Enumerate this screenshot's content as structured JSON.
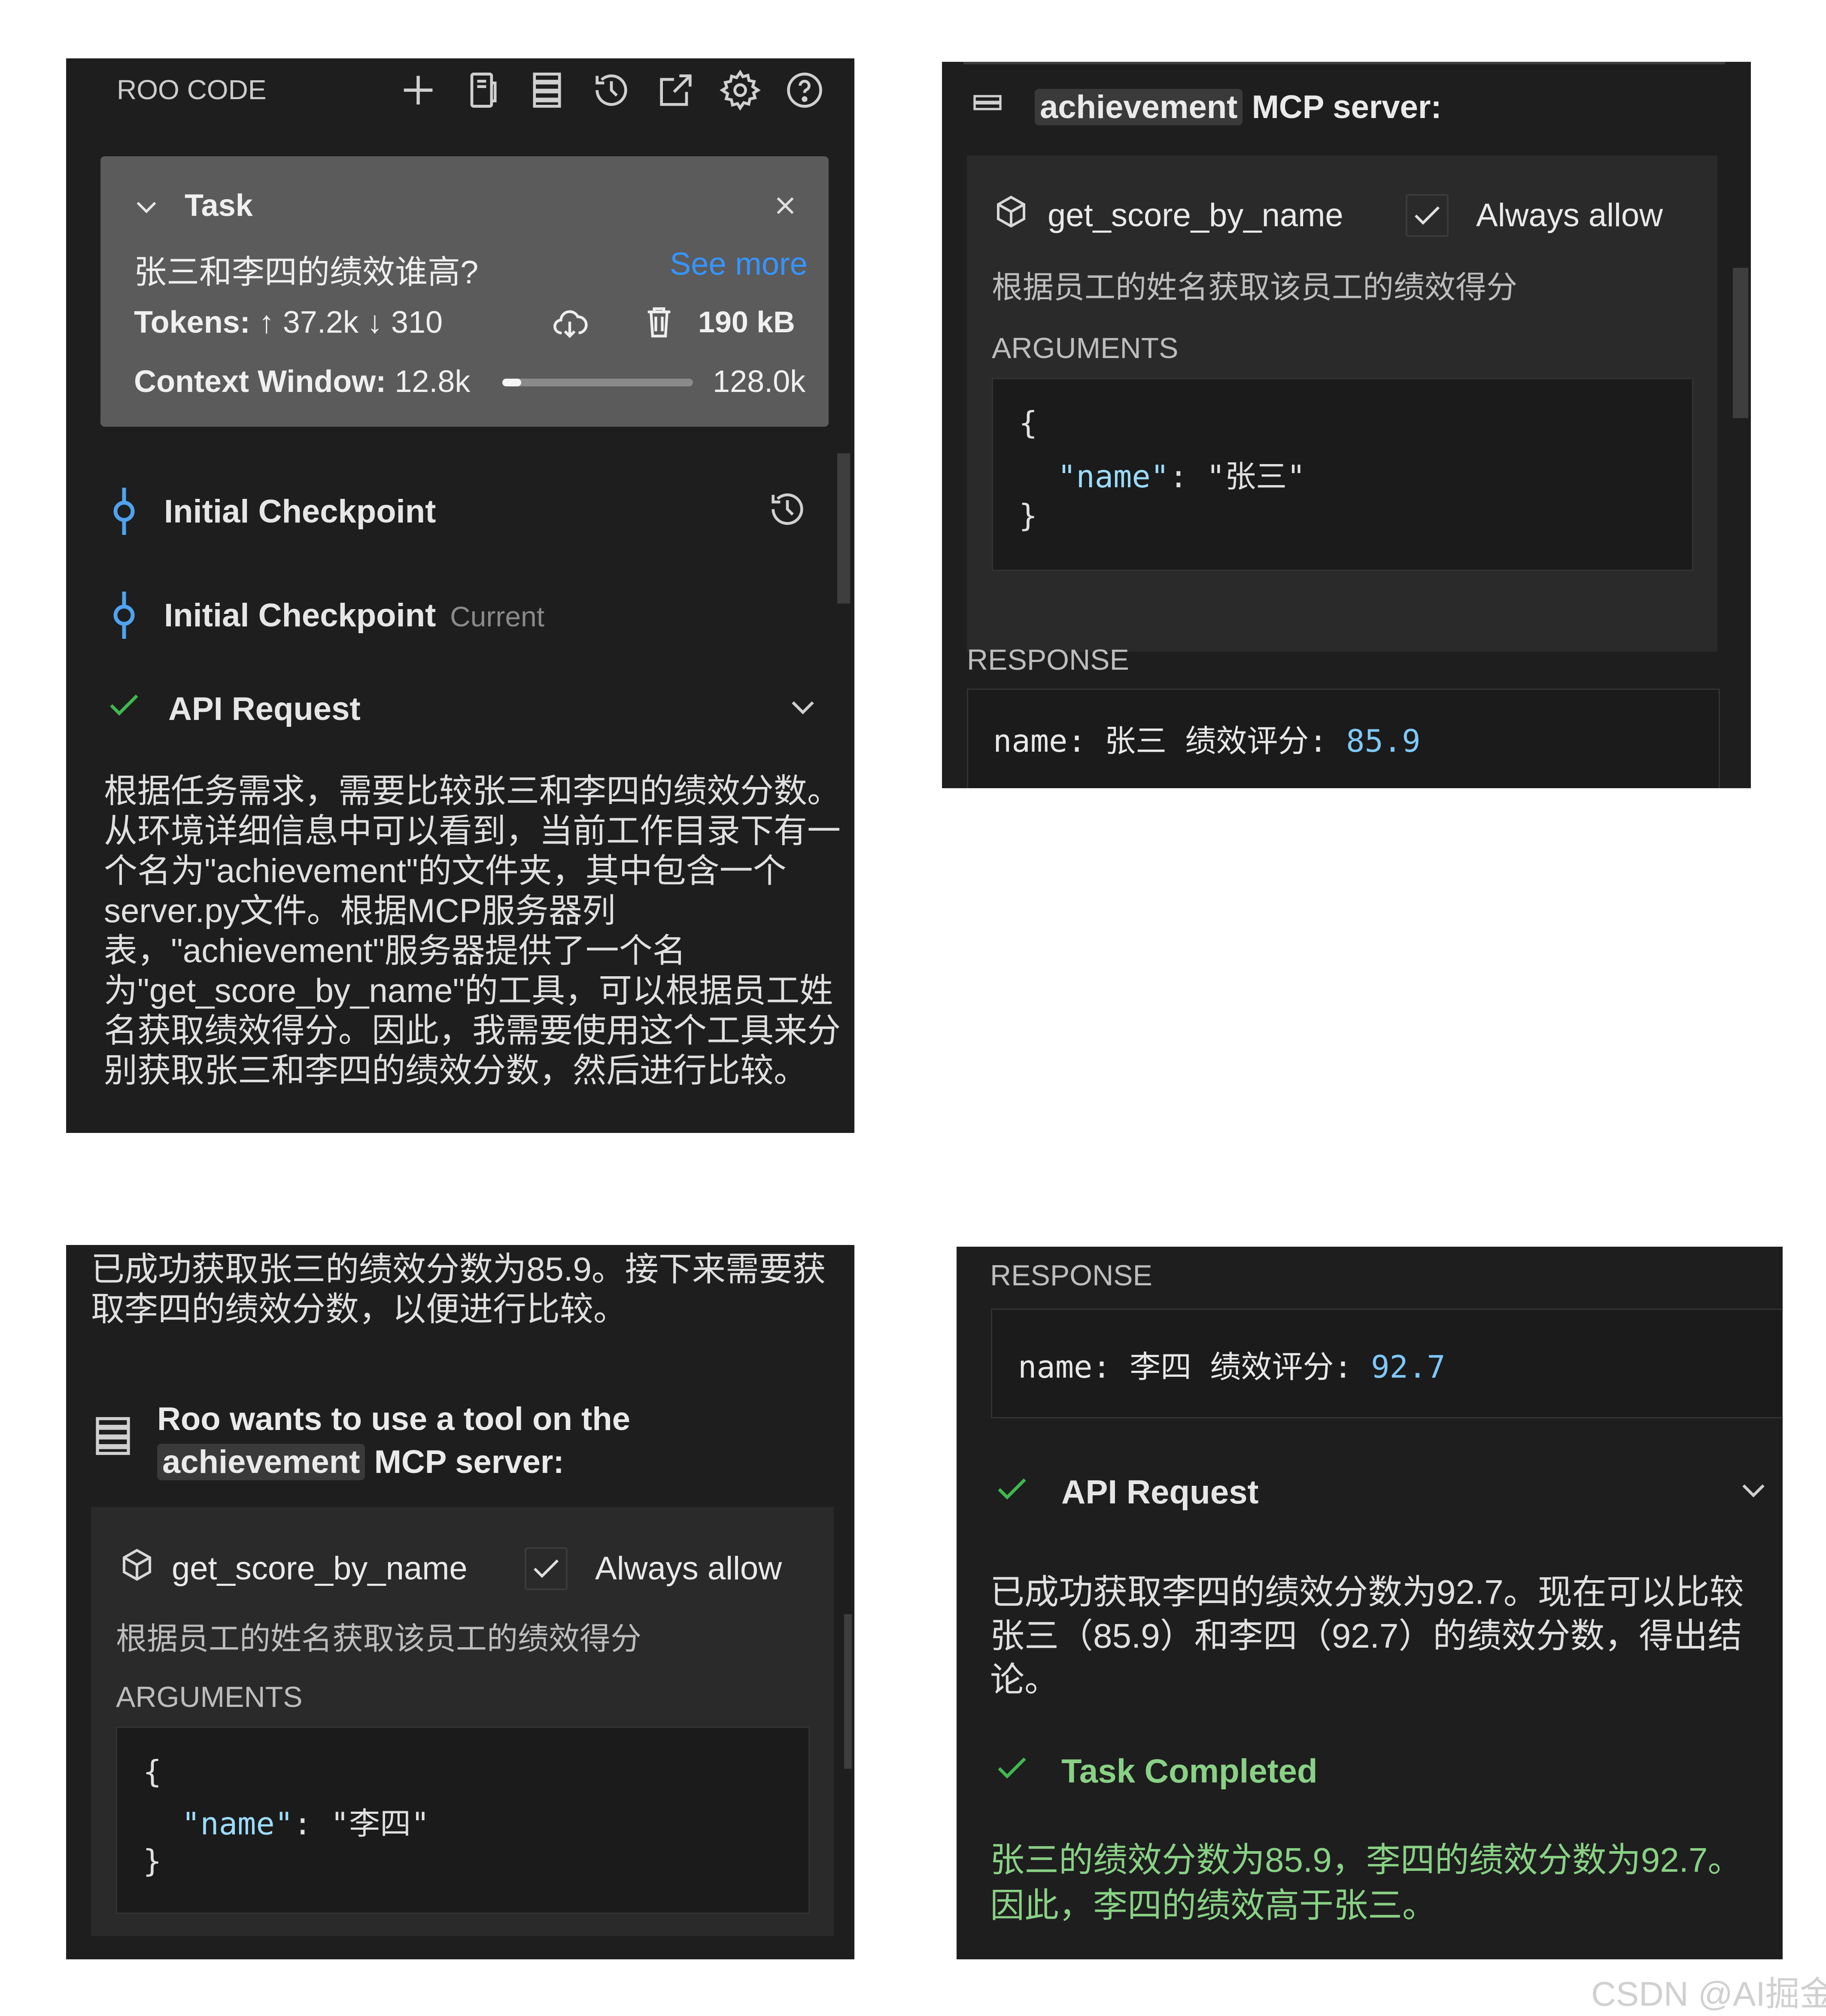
{
  "panel1": {
    "title": "ROO CODE",
    "toolbar_icons": [
      "plus-icon",
      "document-icon",
      "server-list-icon",
      "history-icon",
      "popout-icon",
      "gear-icon",
      "help-icon"
    ],
    "task": {
      "label": "Task",
      "question": "张三和李四的绩效谁高?",
      "see_more": "See more",
      "tokens_label": "Tokens:",
      "tokens_up": "37.2k",
      "tokens_down": "310",
      "size": "190 kB",
      "context_label": "Context Window:",
      "context_used": "12.8k",
      "context_max": "128.0k",
      "context_fraction": 0.1
    },
    "checkpoint1": "Initial Checkpoint",
    "checkpoint2": "Initial Checkpoint",
    "checkpoint2_badge": "Current",
    "api_request": "API Request",
    "reasoning_lines": [
      "根据任务需求，需要比较张三和李四的绩效分数。",
      "从环境详细信息中可以看到，当前工作目录下有一",
      "个名为\"achievement\"的文件夹，其中包含一个",
      "server.py文件。根据MCP服务器列",
      "表，\"achievement\"服务器提供了一个名",
      "为\"get_score_by_name\"的工具，可以根据员工姓",
      "名获取绩效得分。因此，我需要使用这个工具来分",
      "别获取张三和李四的绩效分数，然后进行比较。"
    ]
  },
  "panel2": {
    "server_name": "achievement",
    "server_suffix": "MCP server:",
    "tool_name": "get_score_by_name",
    "always_allow": "Always allow",
    "tool_desc": "根据员工的姓名获取该员工的绩效得分",
    "arguments_label": "ARGUMENTS",
    "code_open": "{",
    "code_key": "\"name\"",
    "code_colon": ":",
    "code_value": "\"张三\"",
    "code_close": "}",
    "response_label": "RESPONSE",
    "response_prefix": "name: 张三 绩效评分:",
    "response_value": "85.9"
  },
  "panel3": {
    "intro_lines": [
      "已成功获取张三的绩效分数为85.9。接下来需要获",
      "取李四的绩效分数，以便进行比较。"
    ],
    "wants_line1": "Roo wants to use a tool on the",
    "server_name": "achievement",
    "server_suffix": "MCP server:",
    "tool_name": "get_score_by_name",
    "always_allow": "Always allow",
    "tool_desc": "根据员工的姓名获取该员工的绩效得分",
    "arguments_label": "ARGUMENTS",
    "code_open": "{",
    "code_key": "\"name\"",
    "code_colon": ":",
    "code_value": "\"李四\"",
    "code_close": "}"
  },
  "panel4": {
    "response_label": "RESPONSE",
    "response_prefix": "name: 李四 绩效评分:",
    "response_value": "92.7",
    "api_request": "API Request",
    "text_lines": [
      "已成功获取李四的绩效分数为92.7。现在可以比较",
      "张三（85.9）和李四（92.7）的绩效分数，得出结",
      "论。"
    ],
    "task_completed": "Task Completed",
    "result_lines": [
      "张三的绩效分数为85.9，李四的绩效分数为92.7。",
      "因此，李四的绩效高于张三。"
    ]
  },
  "watermark": "CSDN @AI掘金",
  "colors": {
    "panel_bg": "#1e1e1e",
    "task_bg": "#5b5b5b",
    "link": "#3794ff",
    "check_green": "#3fb950",
    "completed_green": "#89d185",
    "json_key": "#9cdcfe",
    "number_blue": "#7fc8f8",
    "checkpoint_blue": "#4fa3f0"
  }
}
